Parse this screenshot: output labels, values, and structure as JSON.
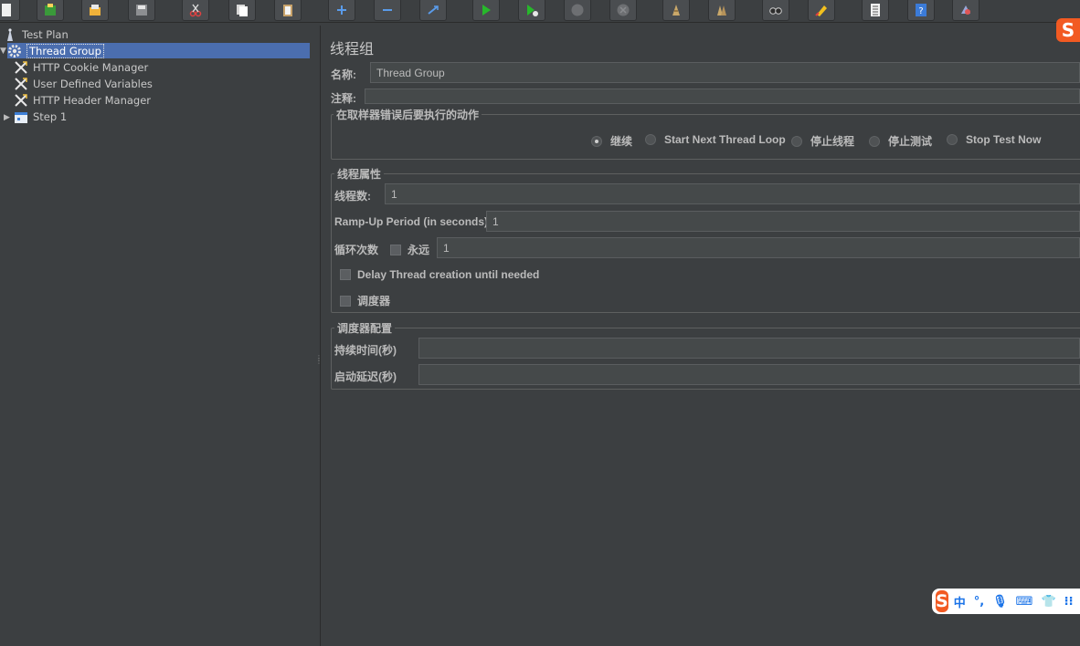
{
  "toolbar": {
    "buttons": [
      {
        "icon": "new-icon"
      },
      {
        "icon": "templates-icon"
      },
      {
        "icon": "open-icon"
      },
      {
        "icon": "save-icon"
      },
      {
        "icon": "cut-icon"
      },
      {
        "icon": "copy-icon"
      },
      {
        "icon": "paste-icon"
      },
      {
        "icon": "expand-icon"
      },
      {
        "icon": "collapse-icon"
      },
      {
        "icon": "toggle-icon"
      },
      {
        "icon": "start-icon"
      },
      {
        "icon": "start-no-pauses-icon"
      },
      {
        "icon": "stop-icon"
      },
      {
        "icon": "shutdown-icon"
      },
      {
        "icon": "clear-icon"
      },
      {
        "icon": "clear-all-icon"
      },
      {
        "icon": "search-icon"
      },
      {
        "icon": "reset-search-icon"
      },
      {
        "icon": "function-helper-icon"
      },
      {
        "icon": "help-icon"
      },
      {
        "icon": "remote-icon"
      }
    ]
  },
  "tree": {
    "items": [
      {
        "label": "Test Plan",
        "icon": "test-plan-icon"
      },
      {
        "label": "Thread Group",
        "icon": "gear-icon"
      },
      {
        "label": "HTTP Cookie Manager",
        "icon": "config-element-icon"
      },
      {
        "label": "User Defined Variables",
        "icon": "config-element-icon"
      },
      {
        "label": "HTTP Header Manager",
        "icon": "config-element-icon"
      },
      {
        "label": "Step 1",
        "icon": "transaction-controller-icon"
      }
    ]
  },
  "panel": {
    "title": "线程组",
    "name_label": "名称:",
    "name_value": "Thread Group",
    "comment_label": "注释:",
    "comment_value": "",
    "error_action": {
      "title": "在取样器错误后要执行的动作",
      "options": [
        "继续",
        "Start Next Thread Loop",
        "停止线程",
        "停止测试",
        "Stop Test Now"
      ],
      "selected": "继续"
    },
    "thread_props": {
      "title": "线程属性",
      "threads_label": "线程数:",
      "threads_value": "1",
      "rampup_label": "Ramp-Up Period (in seconds):",
      "rampup_value": "1",
      "loop_label": "循环次数",
      "forever_label": "永远",
      "loop_value": "1",
      "delay_label": "Delay Thread creation until needed",
      "scheduler_label": "调度器"
    },
    "scheduler_config": {
      "title": "调度器配置",
      "duration_label": "持续时间(秒)",
      "duration_value": "",
      "delay_label": "启动延迟(秒)",
      "delay_value": ""
    }
  },
  "ime": {
    "logo": "S",
    "items": [
      "中",
      "°,",
      "🎙",
      "⌨",
      "👕",
      "⁝⁝"
    ]
  }
}
